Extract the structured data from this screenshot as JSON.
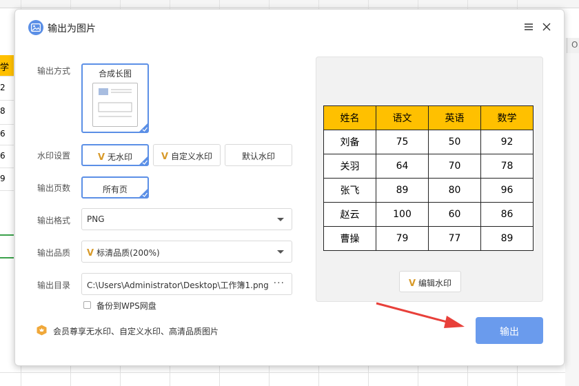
{
  "background_sheet": {
    "left_header": "学",
    "left_cells": [
      "2",
      "8",
      "6",
      "6",
      "9"
    ],
    "right_col_label": "O"
  },
  "dialog": {
    "title": "输出为图片",
    "output_mode": {
      "label": "输出方式",
      "option": "合成长图"
    },
    "watermark": {
      "label": "水印设置",
      "options": [
        "无水印",
        "自定义水印",
        "默认水印"
      ]
    },
    "pages": {
      "label": "输出页数",
      "value": "所有页"
    },
    "format": {
      "label": "输出格式",
      "value": "PNG"
    },
    "quality": {
      "label": "输出品质",
      "value": "标清品质(200%)"
    },
    "directory": {
      "label": "输出目录",
      "value": "C:\\Users\\Administrator\\Desktop\\工作簿1.png",
      "more": "···"
    },
    "backup_label": "备份到WPS网盘",
    "vip_note": "会员尊享无水印、自定义水印、高清品质图片",
    "preview": {
      "headers": [
        "姓名",
        "语文",
        "英语",
        "数学"
      ],
      "rows": [
        [
          "刘备",
          "75",
          "50",
          "92"
        ],
        [
          "关羽",
          "64",
          "70",
          "78"
        ],
        [
          "张飞",
          "89",
          "80",
          "96"
        ],
        [
          "赵云",
          "100",
          "60",
          "86"
        ],
        [
          "曹操",
          "79",
          "77",
          "89"
        ]
      ],
      "edit_watermark": "编辑水印"
    },
    "export_button": "输出"
  },
  "colors": {
    "accent": "#5b8fe6",
    "export_button": "#6a9bed",
    "table_header": "#ffc000",
    "vip_gold": "#d89a2a",
    "arrow": "#e8403a"
  }
}
